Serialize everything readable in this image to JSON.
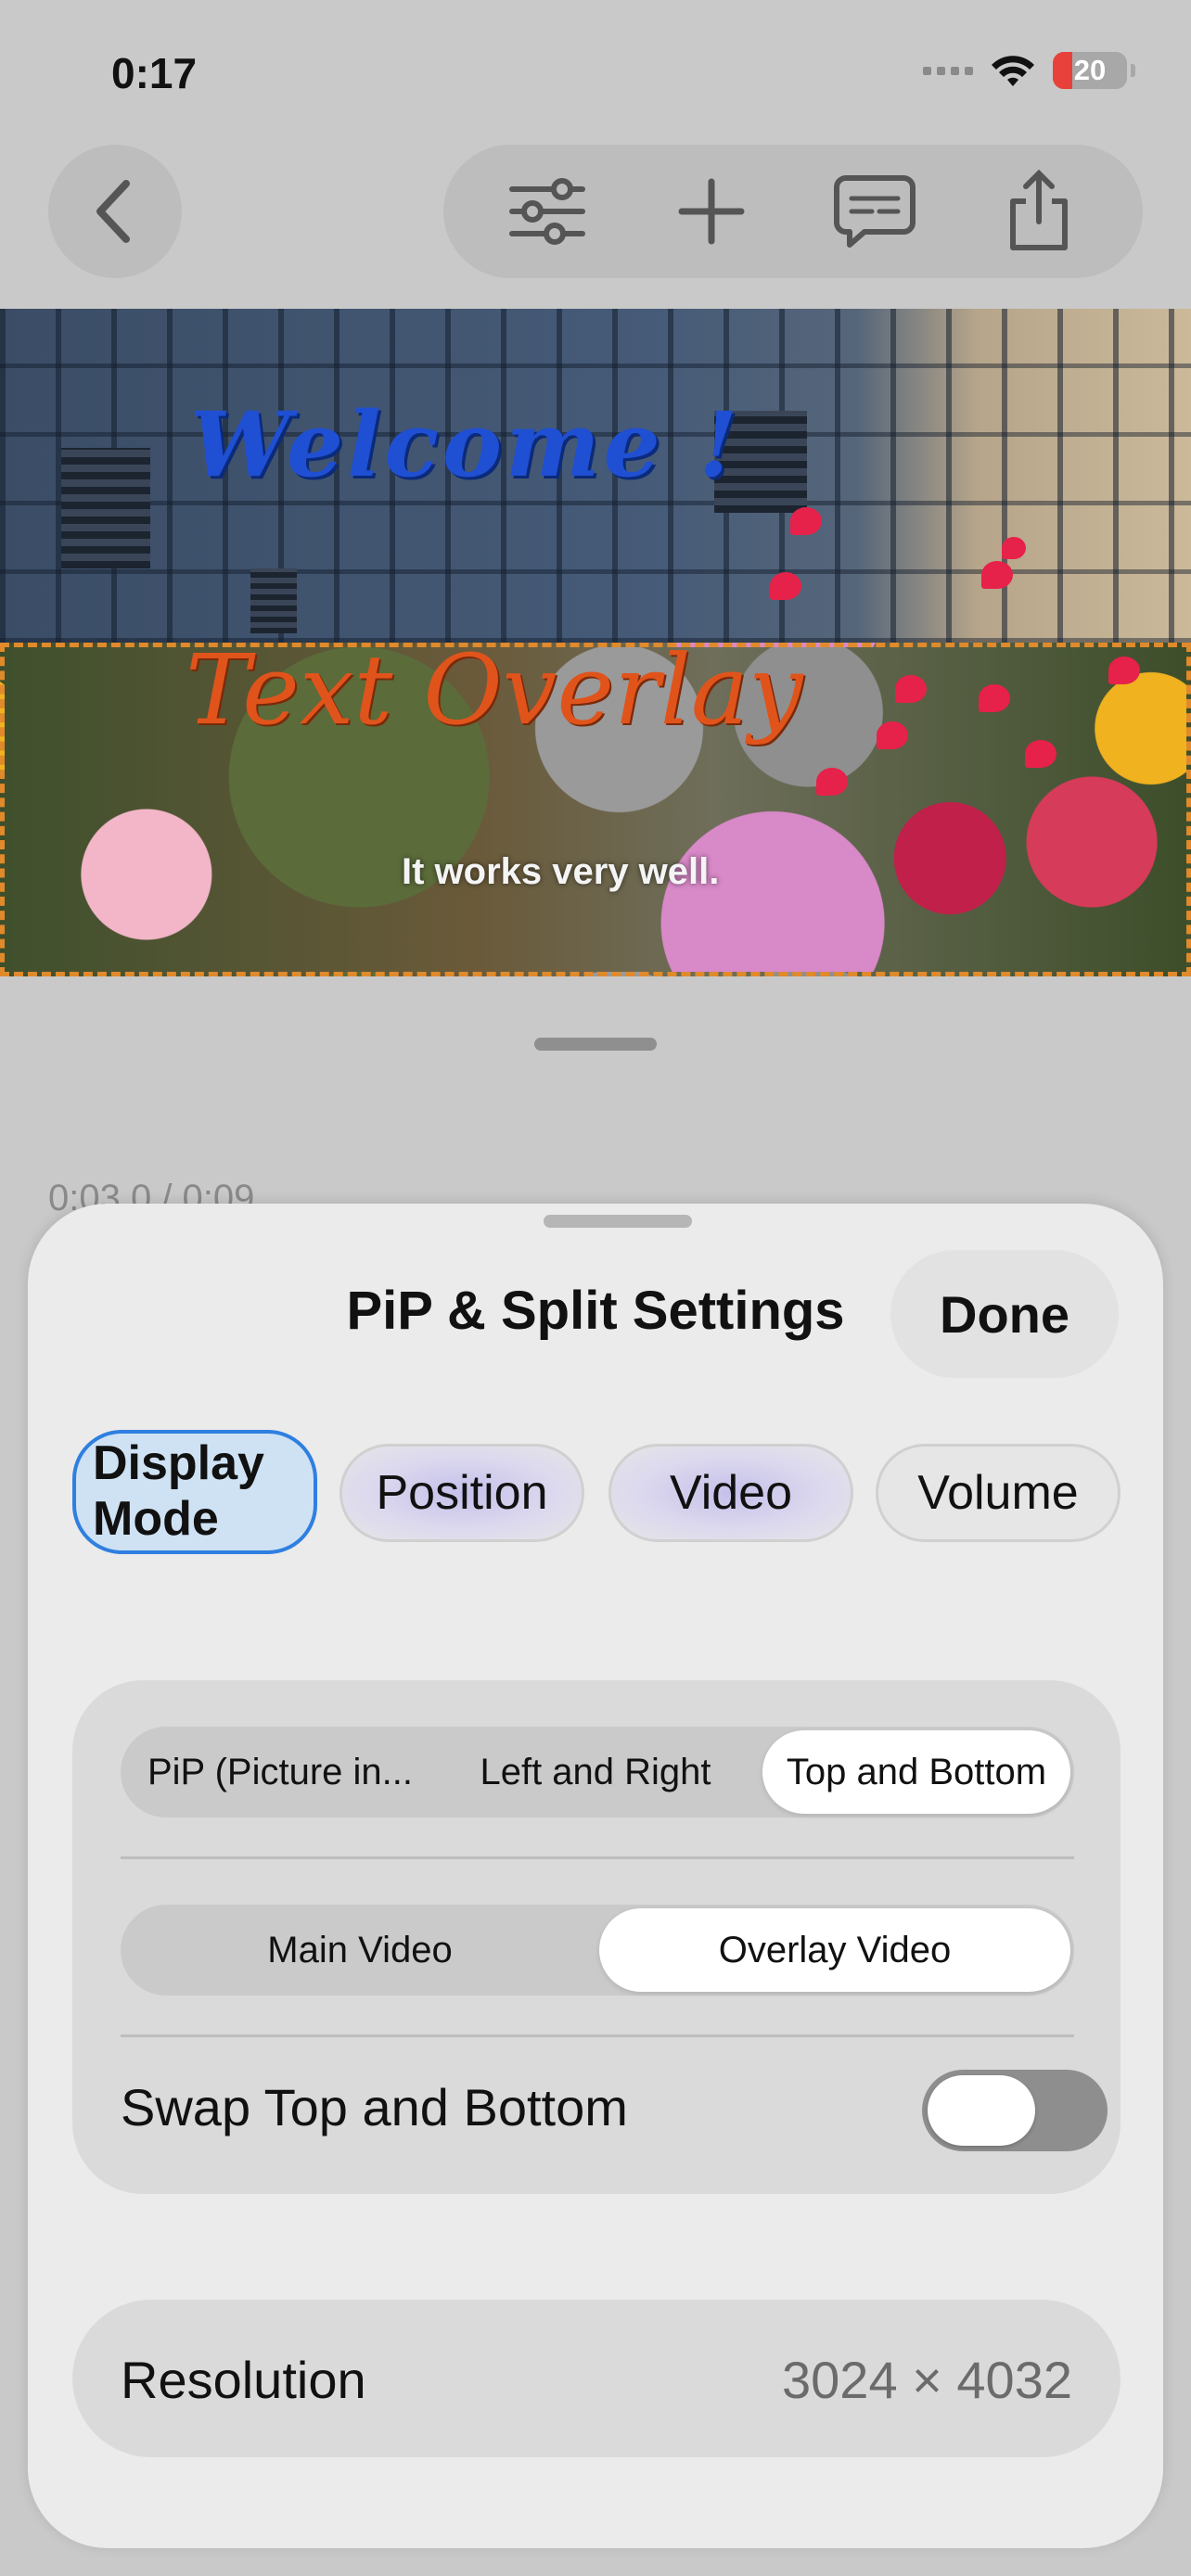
{
  "status_bar": {
    "time": "0:17",
    "battery": "20",
    "battery_color": "#e8413b"
  },
  "toolbar": {
    "back_icon": "chevron-left-icon",
    "icons": [
      "sliders-icon",
      "plus-icon",
      "message-icon",
      "share-icon"
    ]
  },
  "video": {
    "title_text": "Welcome !",
    "overlay_text": "Text Overlay",
    "caption": "It works very well."
  },
  "player": {
    "time": "0:03.0 / 0:09"
  },
  "sheet": {
    "title": "PiP & Split Settings",
    "done_label": "Done",
    "tabs": [
      {
        "label": "Display Mode",
        "active": true
      },
      {
        "label": "Position",
        "active": false
      },
      {
        "label": "Video",
        "active": false
      },
      {
        "label": "Volume",
        "active": false
      }
    ],
    "layout_modes": [
      "PiP (Picture in...",
      "Left and Right",
      "Top and Bottom"
    ],
    "layout_selected": "Top and Bottom",
    "video_modes": [
      "Main Video",
      "Overlay Video"
    ],
    "video_selected": "Overlay Video",
    "swap_label": "Swap Top and Bottom",
    "swap_on": false,
    "resolution_label": "Resolution",
    "resolution_value": "3024 × 4032",
    "accent_color": "#2f7fe0"
  }
}
